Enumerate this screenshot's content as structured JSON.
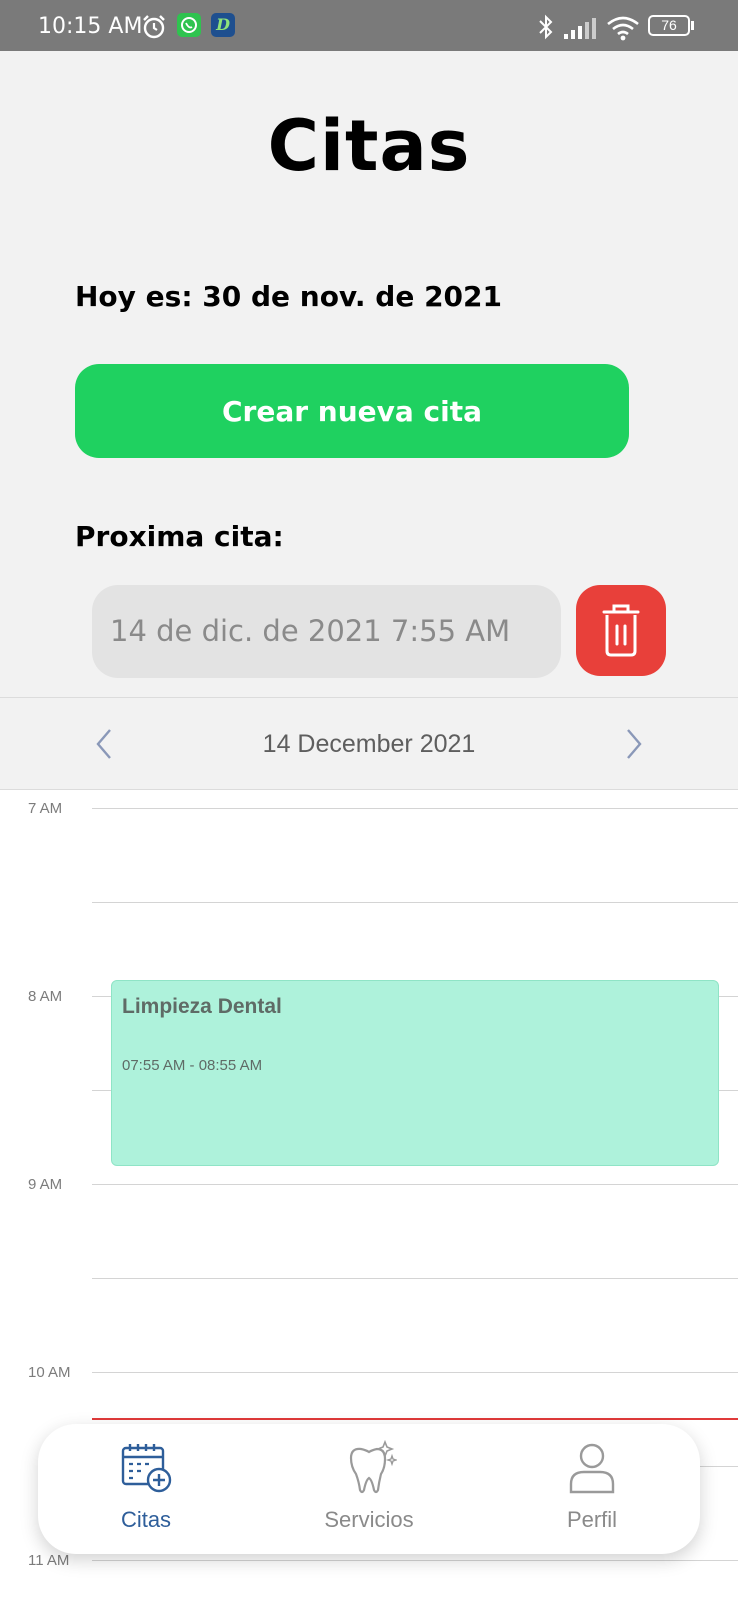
{
  "status_bar": {
    "time": "10:15 AM",
    "battery": "76"
  },
  "header": {
    "title": "Citas",
    "today_text": "Hoy es: 30 de nov. de 2021",
    "create_button_label": "Crear nueva cita",
    "next_label": "Proxima cita:",
    "next_value": "14 de dic. de 2021 7:55 AM"
  },
  "calendar": {
    "date_title": "14 December 2021",
    "hours": [
      "7 AM",
      "8 AM",
      "9 AM",
      "10 AM",
      "11 AM"
    ],
    "event": {
      "title": "Limpieza Dental",
      "time_range": "07:55 AM - 08:55 AM"
    }
  },
  "bottom_nav": {
    "tabs": [
      {
        "label": "Citas",
        "icon": "calendar-plus-icon",
        "active": true
      },
      {
        "label": "Servicios",
        "icon": "tooth-sparkle-icon",
        "active": false
      },
      {
        "label": "Perfil",
        "icon": "user-icon",
        "active": false
      }
    ]
  },
  "colors": {
    "primary_green": "#1fd160",
    "delete_red": "#e8403a",
    "event_bg": "#aef2db",
    "active_tab": "#2e5e9a",
    "inactive_tab": "#8a8a8a",
    "now_line": "#e03a3a"
  }
}
